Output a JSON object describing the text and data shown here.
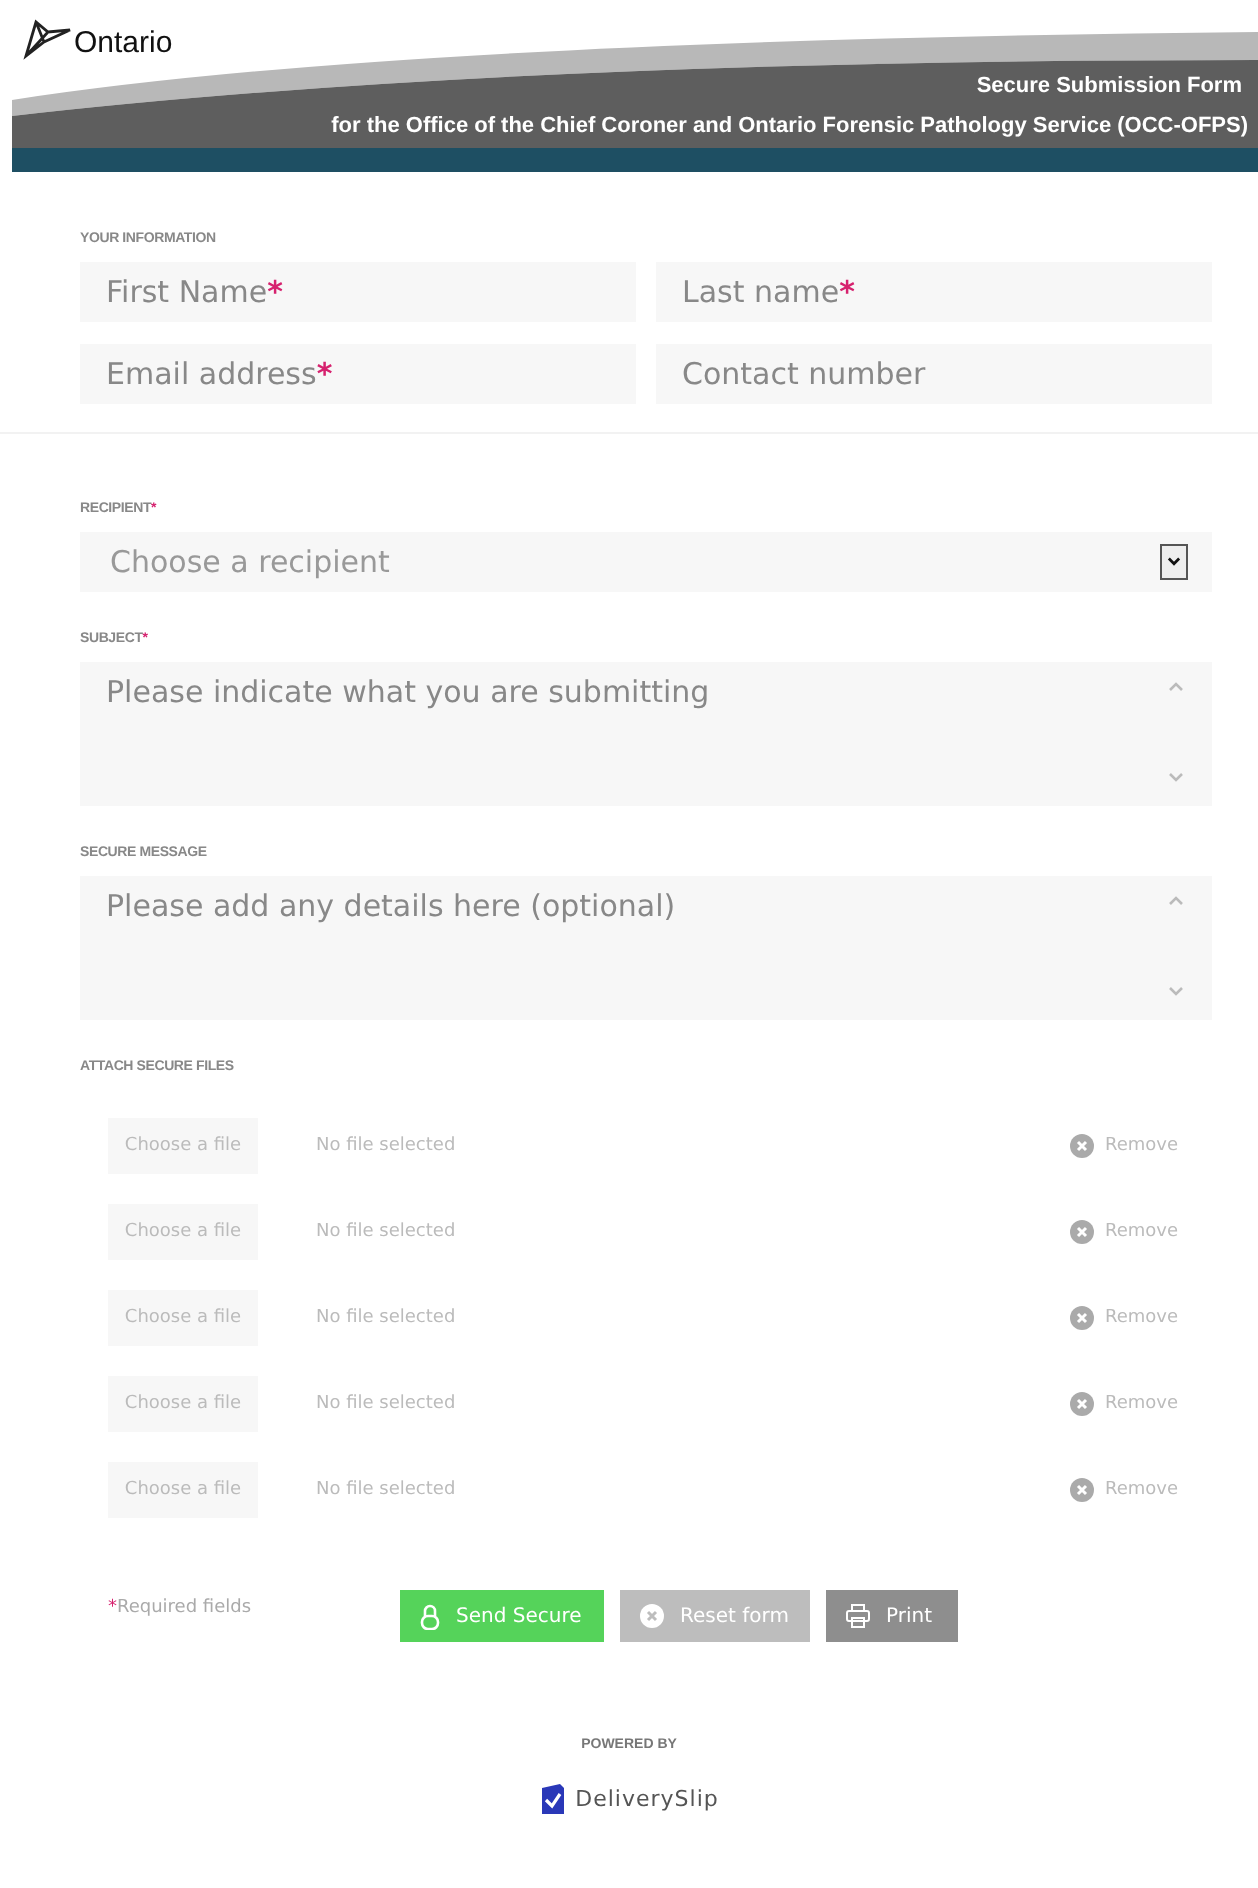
{
  "header": {
    "logo": "Ontario",
    "title": "Secure Submission Form",
    "subtitle": "for the Office of the Chief Coroner and Ontario Forensic Pathology Service (OCC-OFPS)"
  },
  "your_information": {
    "label": "YOUR INFORMATION",
    "fields": [
      {
        "placeholder": "First Name",
        "required_mark": "*"
      },
      {
        "placeholder": "Last name",
        "required_mark": "*"
      },
      {
        "placeholder": "Email address",
        "required_mark": "*"
      },
      {
        "placeholder": "Contact number"
      }
    ]
  },
  "recipient": {
    "label": "RECIPIENT",
    "required_mark": "*",
    "placeholder": "Choose a recipient"
  },
  "subject": {
    "label": "SUBJECT",
    "required_mark": "*",
    "placeholder": "Please indicate what you are submitting"
  },
  "secure_message": {
    "label": "SECURE MESSAGE",
    "placeholder": "Please add any details here (optional)"
  },
  "attachments": {
    "label": "ATTACH SECURE FILES",
    "rows": [
      {
        "button": "Choose a file",
        "status": "No file selected",
        "remove": "Remove"
      },
      {
        "button": "Choose a file",
        "status": "No file selected",
        "remove": "Remove"
      },
      {
        "button": "Choose a file",
        "status": "No file selected",
        "remove": "Remove"
      },
      {
        "button": "Choose a file",
        "status": "No file selected",
        "remove": "Remove"
      },
      {
        "button": "Choose a file",
        "status": "No file selected",
        "remove": "Remove"
      }
    ]
  },
  "footer": {
    "required_mark": "*",
    "required_note": "Required fields",
    "buttons": [
      {
        "kind": "send",
        "label": "Send Secure"
      },
      {
        "kind": "reset",
        "label": "Reset form"
      },
      {
        "kind": "print",
        "label": "Print"
      }
    ],
    "powered_by": "POWERED BY",
    "brand": "DeliverySlip"
  }
}
